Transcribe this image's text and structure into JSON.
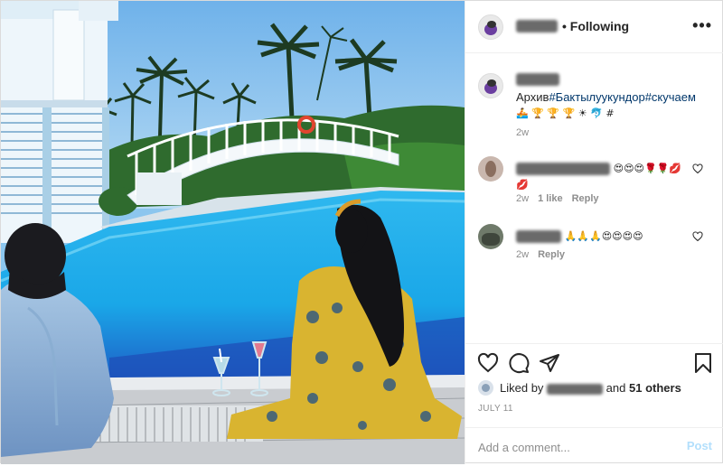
{
  "header": {
    "following_label": "• Following",
    "more_label": "•••"
  },
  "caption": {
    "text_prefix": "Архив",
    "hashtags": "#Бактылуукундор#скучаем",
    "emoji_line": "🚣 🏆 🏆 🏆 ☀ 🐬 #",
    "time": "2w"
  },
  "comments": [
    {
      "emojis": "😍😍😍🌹🌹💋💋",
      "time": "2w",
      "likes": "1 like",
      "reply": "Reply"
    },
    {
      "emojis": "🙏🙏🙏😍😍😍😍",
      "time": "2w",
      "reply": "Reply"
    }
  ],
  "likes": {
    "prefix": "Liked by",
    "and_text": "and",
    "others": "51 others"
  },
  "date": "JULY 11",
  "add_comment": {
    "placeholder": "Add a comment...",
    "post_label": "Post"
  },
  "icons": {
    "like": "heart-icon",
    "comment": "comment-icon",
    "share": "share-icon",
    "save": "bookmark-icon"
  },
  "colors": {
    "hashtag": "#00376b",
    "muted": "#8e8e8e",
    "post_button": "#b2dffc"
  }
}
